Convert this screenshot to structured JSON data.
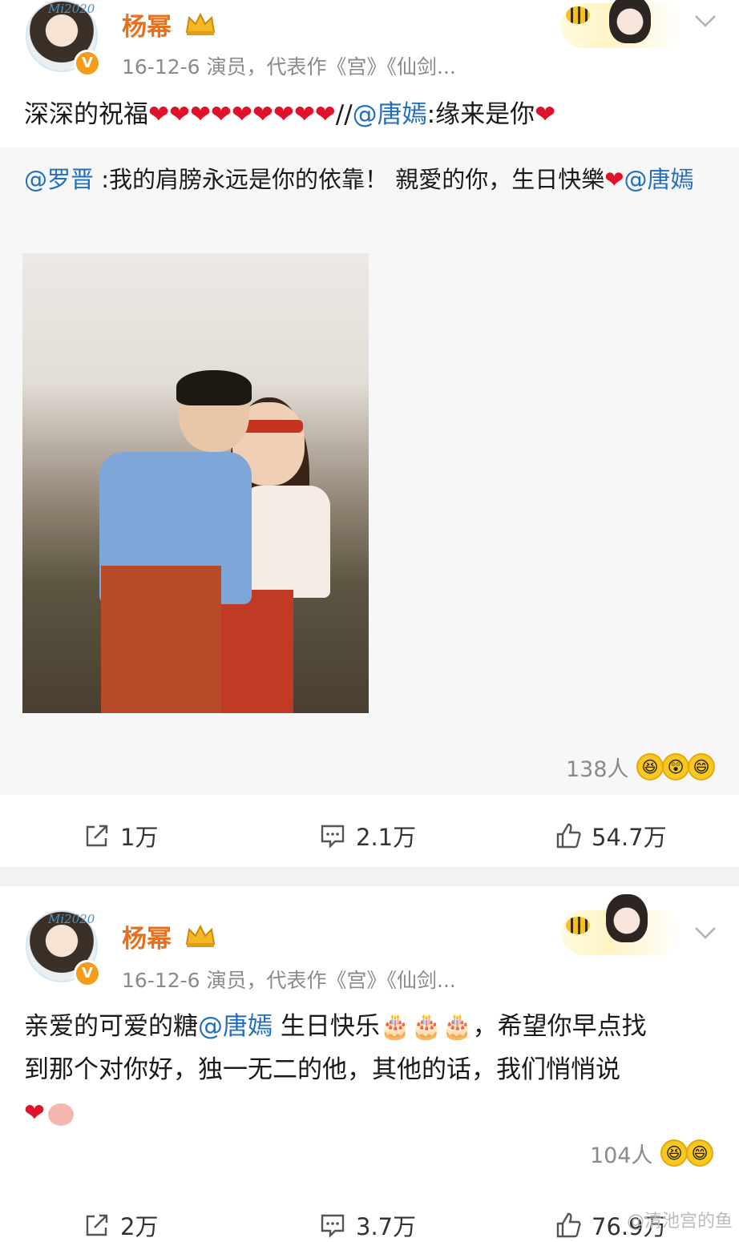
{
  "post1": {
    "author": "杨幂",
    "verified_badge": "V",
    "avatar_tag": "Mi2020",
    "meta": "16-12-6   演员，代表作《宫》《仙剑...",
    "text_prefix": "深深的祝福",
    "hearts": "❤❤❤❤❤❤❤❤❤",
    "text_sep": "//",
    "mention": "@唐嫣",
    "text_suffix": ":缘来是你",
    "text_suffix_heart": "❤",
    "repost": {
      "author_mention": "@罗晋",
      "text": " :我的肩膀永远是你的依靠！ 親愛的你，生日快樂",
      "heart": "❤",
      "mention": "@唐嫣"
    },
    "reaction_count": "138人",
    "actions": {
      "share": "1万",
      "comment": "2.1万",
      "like": "54.7万"
    }
  },
  "post2": {
    "author": "杨幂",
    "verified_badge": "V",
    "avatar_tag": "Mi2020",
    "meta": "16-12-6   演员，代表作《宫》《仙剑...",
    "text_a": "亲爱的可爱的糖",
    "mention": "@唐嫣",
    "text_b": " 生日快乐",
    "cakes": "🎂🎂🎂",
    "text_c": "，希望你早点找",
    "text_line2": "到那个对你好，独一无二的他，其他的话，我们悄悄说",
    "text_line3_heart": "❤",
    "reaction_count": "104人",
    "actions": {
      "share": "2万",
      "comment": "3.7万",
      "like": "76.9万"
    }
  },
  "watermark": "@清池宫的鱼",
  "colors": {
    "name": "#e8701a",
    "mention": "#1f6fbf",
    "heart": "#e0112b",
    "meta": "#8a8a8a"
  },
  "icons": [
    "share-icon",
    "comment-icon",
    "like-icon",
    "chevron-down-icon",
    "crown-icon",
    "bee-icon"
  ]
}
